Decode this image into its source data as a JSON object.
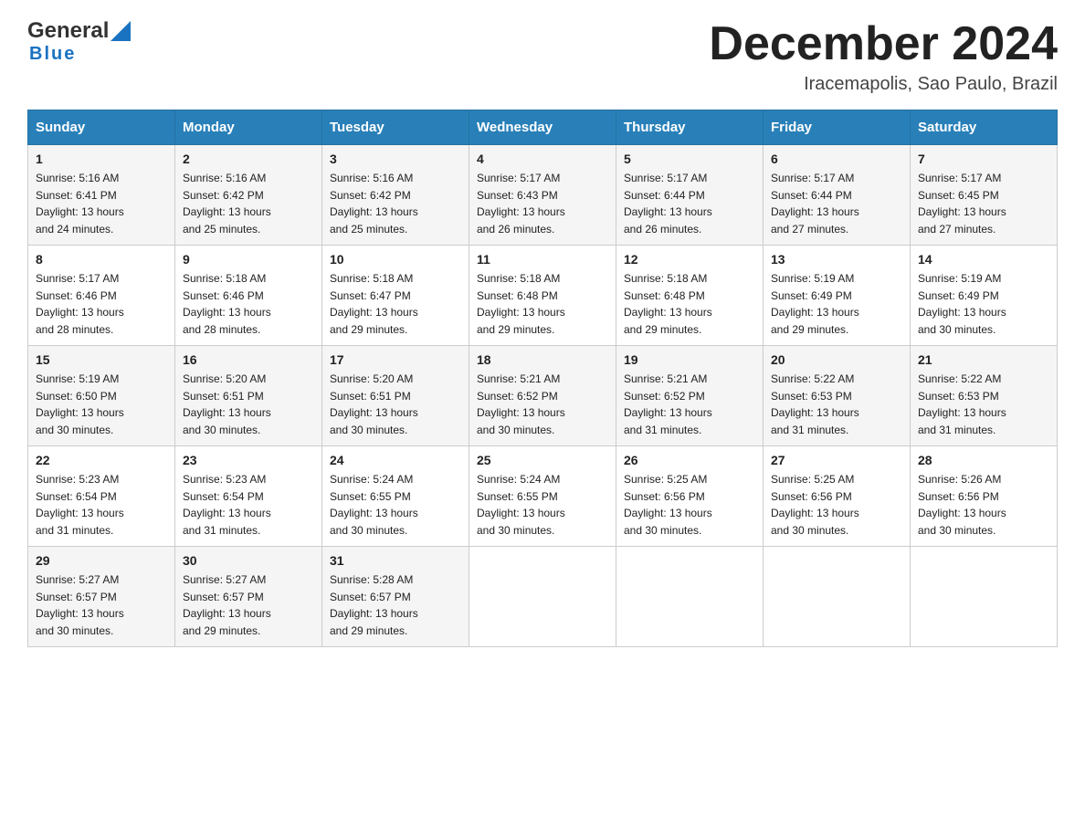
{
  "header": {
    "logo_general": "General",
    "logo_blue": "Blue",
    "month_title": "December 2024",
    "location": "Iracemapolis, Sao Paulo, Brazil"
  },
  "weekdays": [
    "Sunday",
    "Monday",
    "Tuesday",
    "Wednesday",
    "Thursday",
    "Friday",
    "Saturday"
  ],
  "weeks": [
    [
      {
        "day": "1",
        "info": "Sunrise: 5:16 AM\nSunset: 6:41 PM\nDaylight: 13 hours\nand 24 minutes."
      },
      {
        "day": "2",
        "info": "Sunrise: 5:16 AM\nSunset: 6:42 PM\nDaylight: 13 hours\nand 25 minutes."
      },
      {
        "day": "3",
        "info": "Sunrise: 5:16 AM\nSunset: 6:42 PM\nDaylight: 13 hours\nand 25 minutes."
      },
      {
        "day": "4",
        "info": "Sunrise: 5:17 AM\nSunset: 6:43 PM\nDaylight: 13 hours\nand 26 minutes."
      },
      {
        "day": "5",
        "info": "Sunrise: 5:17 AM\nSunset: 6:44 PM\nDaylight: 13 hours\nand 26 minutes."
      },
      {
        "day": "6",
        "info": "Sunrise: 5:17 AM\nSunset: 6:44 PM\nDaylight: 13 hours\nand 27 minutes."
      },
      {
        "day": "7",
        "info": "Sunrise: 5:17 AM\nSunset: 6:45 PM\nDaylight: 13 hours\nand 27 minutes."
      }
    ],
    [
      {
        "day": "8",
        "info": "Sunrise: 5:17 AM\nSunset: 6:46 PM\nDaylight: 13 hours\nand 28 minutes."
      },
      {
        "day": "9",
        "info": "Sunrise: 5:18 AM\nSunset: 6:46 PM\nDaylight: 13 hours\nand 28 minutes."
      },
      {
        "day": "10",
        "info": "Sunrise: 5:18 AM\nSunset: 6:47 PM\nDaylight: 13 hours\nand 29 minutes."
      },
      {
        "day": "11",
        "info": "Sunrise: 5:18 AM\nSunset: 6:48 PM\nDaylight: 13 hours\nand 29 minutes."
      },
      {
        "day": "12",
        "info": "Sunrise: 5:18 AM\nSunset: 6:48 PM\nDaylight: 13 hours\nand 29 minutes."
      },
      {
        "day": "13",
        "info": "Sunrise: 5:19 AM\nSunset: 6:49 PM\nDaylight: 13 hours\nand 29 minutes."
      },
      {
        "day": "14",
        "info": "Sunrise: 5:19 AM\nSunset: 6:49 PM\nDaylight: 13 hours\nand 30 minutes."
      }
    ],
    [
      {
        "day": "15",
        "info": "Sunrise: 5:19 AM\nSunset: 6:50 PM\nDaylight: 13 hours\nand 30 minutes."
      },
      {
        "day": "16",
        "info": "Sunrise: 5:20 AM\nSunset: 6:51 PM\nDaylight: 13 hours\nand 30 minutes."
      },
      {
        "day": "17",
        "info": "Sunrise: 5:20 AM\nSunset: 6:51 PM\nDaylight: 13 hours\nand 30 minutes."
      },
      {
        "day": "18",
        "info": "Sunrise: 5:21 AM\nSunset: 6:52 PM\nDaylight: 13 hours\nand 30 minutes."
      },
      {
        "day": "19",
        "info": "Sunrise: 5:21 AM\nSunset: 6:52 PM\nDaylight: 13 hours\nand 31 minutes."
      },
      {
        "day": "20",
        "info": "Sunrise: 5:22 AM\nSunset: 6:53 PM\nDaylight: 13 hours\nand 31 minutes."
      },
      {
        "day": "21",
        "info": "Sunrise: 5:22 AM\nSunset: 6:53 PM\nDaylight: 13 hours\nand 31 minutes."
      }
    ],
    [
      {
        "day": "22",
        "info": "Sunrise: 5:23 AM\nSunset: 6:54 PM\nDaylight: 13 hours\nand 31 minutes."
      },
      {
        "day": "23",
        "info": "Sunrise: 5:23 AM\nSunset: 6:54 PM\nDaylight: 13 hours\nand 31 minutes."
      },
      {
        "day": "24",
        "info": "Sunrise: 5:24 AM\nSunset: 6:55 PM\nDaylight: 13 hours\nand 30 minutes."
      },
      {
        "day": "25",
        "info": "Sunrise: 5:24 AM\nSunset: 6:55 PM\nDaylight: 13 hours\nand 30 minutes."
      },
      {
        "day": "26",
        "info": "Sunrise: 5:25 AM\nSunset: 6:56 PM\nDaylight: 13 hours\nand 30 minutes."
      },
      {
        "day": "27",
        "info": "Sunrise: 5:25 AM\nSunset: 6:56 PM\nDaylight: 13 hours\nand 30 minutes."
      },
      {
        "day": "28",
        "info": "Sunrise: 5:26 AM\nSunset: 6:56 PM\nDaylight: 13 hours\nand 30 minutes."
      }
    ],
    [
      {
        "day": "29",
        "info": "Sunrise: 5:27 AM\nSunset: 6:57 PM\nDaylight: 13 hours\nand 30 minutes."
      },
      {
        "day": "30",
        "info": "Sunrise: 5:27 AM\nSunset: 6:57 PM\nDaylight: 13 hours\nand 29 minutes."
      },
      {
        "day": "31",
        "info": "Sunrise: 5:28 AM\nSunset: 6:57 PM\nDaylight: 13 hours\nand 29 minutes."
      },
      null,
      null,
      null,
      null
    ]
  ]
}
